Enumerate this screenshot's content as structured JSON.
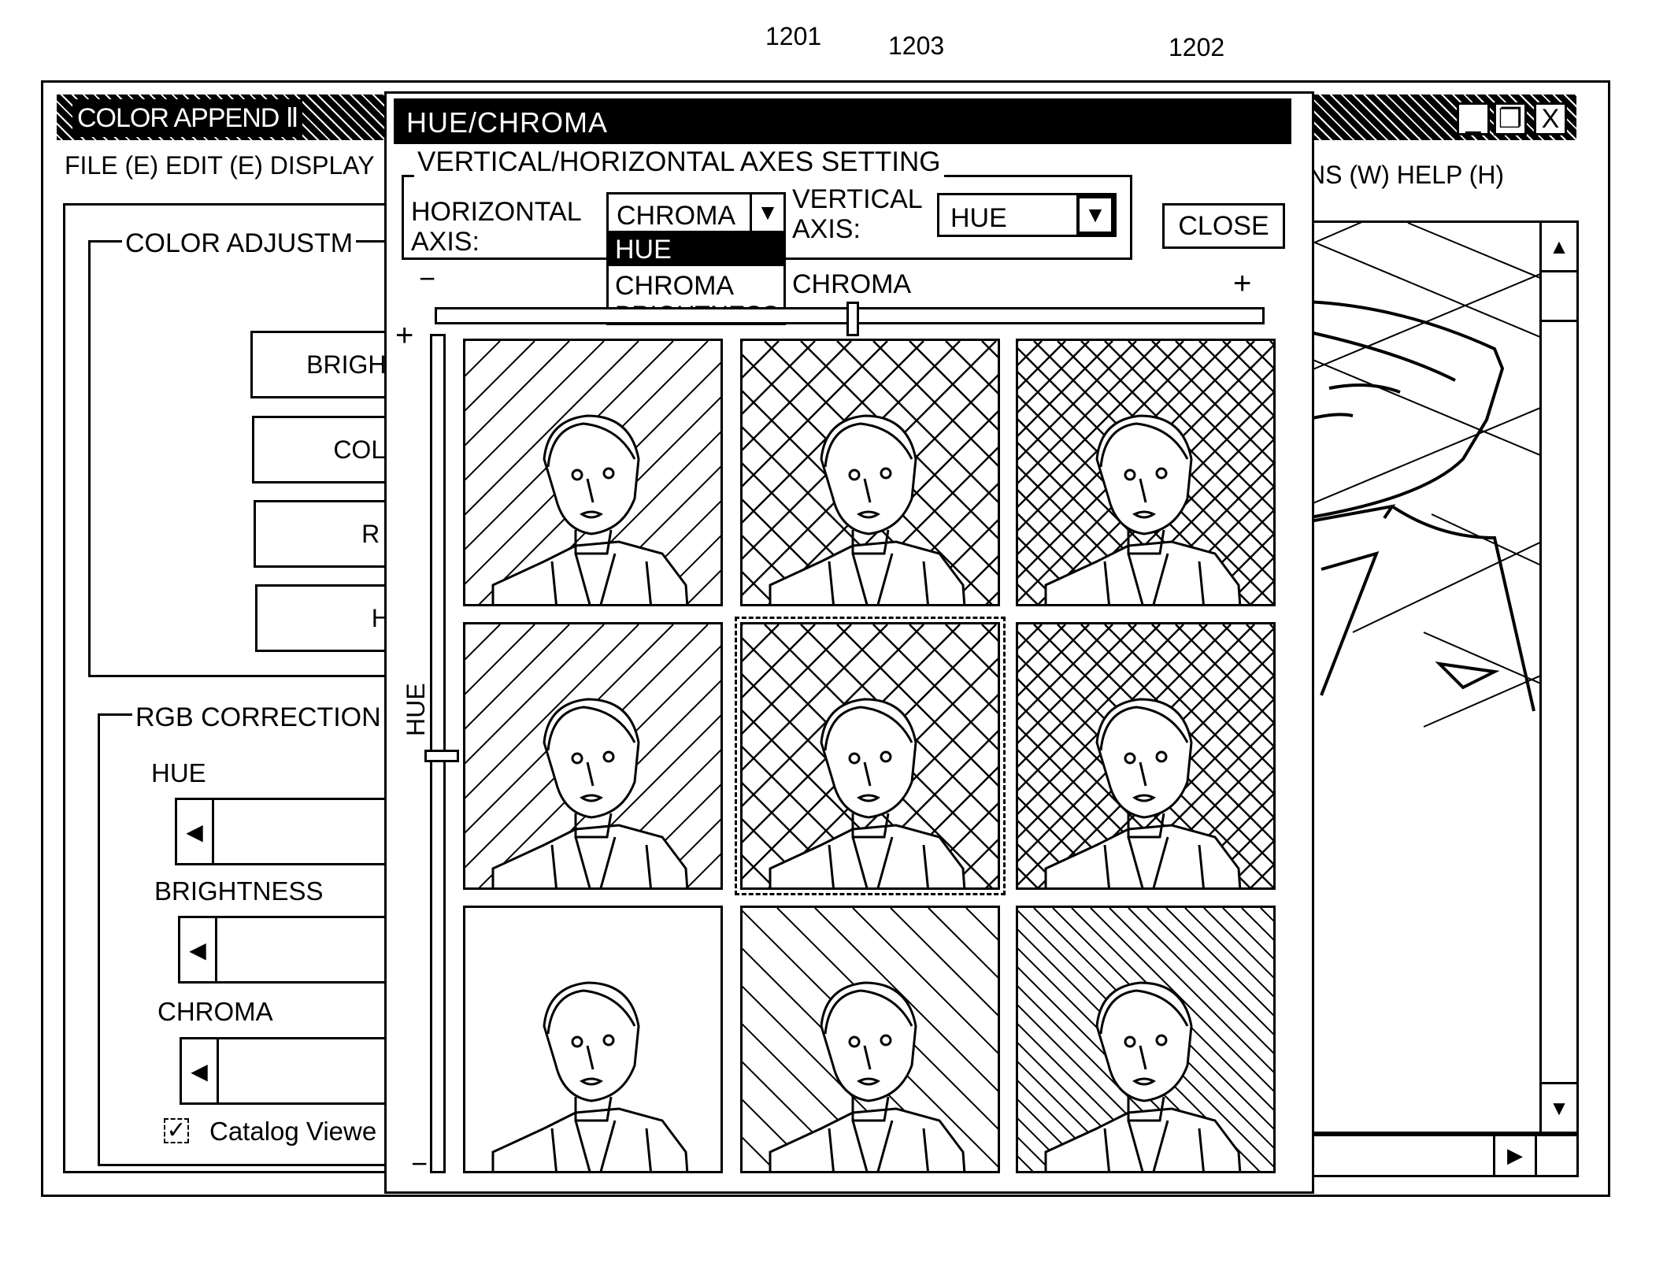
{
  "annotations": {
    "ref_1201": "1201",
    "ref_1203_top": "1203",
    "ref_1202": "1202",
    "ref_1203_right": "1203"
  },
  "main_window": {
    "title": "COLOR APPEND Ⅱ",
    "controls": {
      "minimize": "_",
      "maximize": "❐",
      "close": "X"
    },
    "menu_left": "FILE (E) EDIT (E) DISPLAY",
    "menu_right": "NS (W) HELP (H)",
    "color_adjustment": {
      "group_label": "COLOR ADJUSTM",
      "buttons": [
        "BRIGHT",
        "COLO",
        "R G",
        "HU"
      ]
    },
    "rgb_correction": {
      "group_label": "RGB CORRECTION",
      "sliders": [
        {
          "label": "HUE"
        },
        {
          "label": "BRIGHTNESS"
        },
        {
          "label": "CHROMA"
        }
      ],
      "catalog_viewer": {
        "label": "Catalog Viewe",
        "checked": true
      }
    },
    "preview": {
      "scroll_up": "▲",
      "scroll_down": "▼",
      "scroll_right": "▶"
    }
  },
  "dialog": {
    "title": "HUE/CHROMA",
    "axes_group_label": "VERTICAL/HORIZONTAL AXES SETTING",
    "horizontal_axis": {
      "label_line1": "HORIZONTAL",
      "label_line2": "AXIS:",
      "value": "CHROMA",
      "options": [
        "HUE",
        "CHROMA",
        "BRIGHTNESS"
      ],
      "highlighted_option": "HUE"
    },
    "vertical_axis": {
      "label_line1": "VERTICAL",
      "label_line2": "AXIS:",
      "value": "HUE"
    },
    "close_label": "CLOSE",
    "horizontal_slider": {
      "label": "CHROMA",
      "min_label": "−",
      "max_label": "+",
      "position": 0.5
    },
    "vertical_slider": {
      "label": "HUE",
      "min_label": "−",
      "max_label": "+",
      "position": 0.5
    },
    "dropdown_arrow": "▼",
    "thumbnails": [
      {
        "row": 0,
        "col": 0,
        "pattern": "diag-right-sparse"
      },
      {
        "row": 0,
        "col": 1,
        "pattern": "crosshatch"
      },
      {
        "row": 0,
        "col": 2,
        "pattern": "crosshatch-dense"
      },
      {
        "row": 1,
        "col": 0,
        "pattern": "diag-right-sparse"
      },
      {
        "row": 1,
        "col": 1,
        "pattern": "crosshatch",
        "selected": true
      },
      {
        "row": 1,
        "col": 2,
        "pattern": "crosshatch-dense"
      },
      {
        "row": 2,
        "col": 0,
        "pattern": "none"
      },
      {
        "row": 2,
        "col": 1,
        "pattern": "diag-left-sparse"
      },
      {
        "row": 2,
        "col": 2,
        "pattern": "diag-left-dense"
      }
    ]
  }
}
